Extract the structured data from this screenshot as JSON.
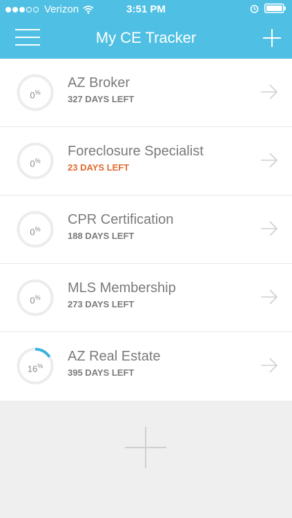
{
  "status_bar": {
    "carrier": "Verizon",
    "time": "3:51 PM",
    "signal_full_dots": 3,
    "signal_empty_dots": 2,
    "icons": [
      "wifi-icon",
      "alarm-icon",
      "battery-icon"
    ]
  },
  "header": {
    "title": "My CE Tracker",
    "icons": [
      "menu-icon",
      "add-icon"
    ]
  },
  "colors": {
    "header_bg": "#4fc0e3",
    "progress_arc": "#3ab3db",
    "urgent_text": "#e2692e",
    "muted_text": "#7a7a7a"
  },
  "courses": [
    {
      "name": "AZ Broker",
      "percent": "0",
      "progress_fraction": 0,
      "days_left": "327 DAYS LEFT",
      "urgent": false
    },
    {
      "name": "Foreclosure Specialist",
      "percent": "0",
      "progress_fraction": 0,
      "days_left": "23 DAYS LEFT",
      "urgent": true
    },
    {
      "name": "CPR Certification",
      "percent": "0",
      "progress_fraction": 0,
      "days_left": "188 DAYS LEFT",
      "urgent": false
    },
    {
      "name": "MLS Membership",
      "percent": "0",
      "progress_fraction": 0,
      "days_left": "273 DAYS LEFT",
      "urgent": false
    },
    {
      "name": "AZ Real Estate",
      "percent": "16",
      "progress_fraction": 0.16,
      "days_left": "395 DAYS LEFT",
      "urgent": false
    }
  ],
  "percent_symbol": "%"
}
